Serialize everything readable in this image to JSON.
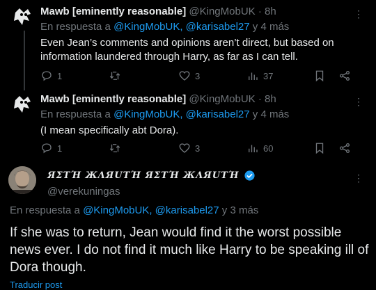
{
  "tweets": [
    {
      "name": "Mawb [eminently reasonable]",
      "handle": "@KingMobUK",
      "time": "· 8h",
      "reply_prefix": "En respuesta a",
      "reply_to": "@KingMobUK, @karisabel27",
      "reply_suffix": "y 4 más",
      "text": "Even Jean’s comments and opinions aren’t direct, but based on information laundered through Harry, as far as I can tell.",
      "replies": "1",
      "retweets": "",
      "likes": "3",
      "views": "37"
    },
    {
      "name": "Mawb [eminently reasonable]",
      "handle": "@KingMobUK",
      "time": "· 8h",
      "reply_prefix": "En respuesta a",
      "reply_to": "@KingMobUK, @karisabel27",
      "reply_suffix": "y 4 más",
      "text": "(I mean specifically abt Dora).",
      "replies": "1",
      "retweets": "",
      "likes": "3",
      "views": "60"
    }
  ],
  "main_tweet": {
    "display_name": "ЯΣΤΉ ЖΛЯUΤΉ ЯΣΤΉ ЖΛЯUΤΉ",
    "handle": "@verekuningas",
    "reply_prefix": "En respuesta a",
    "reply_to": "@KingMobUK, @karisabel27",
    "reply_suffix": "y 3 más",
    "text": "If she was to return, Jean would find it the worst possible news ever. I do not find it much like Harry to be speaking ill of Dora though.",
    "translate": "Traducir post"
  },
  "colors": {
    "background": "#000000",
    "text": "#e7e9ea",
    "muted": "#71767b",
    "accent": "#1d9bf0"
  },
  "icons": [
    "reply-icon",
    "retweet-icon",
    "like-icon",
    "views-icon",
    "bookmark-icon",
    "share-icon",
    "more-icon",
    "verified-icon"
  ]
}
